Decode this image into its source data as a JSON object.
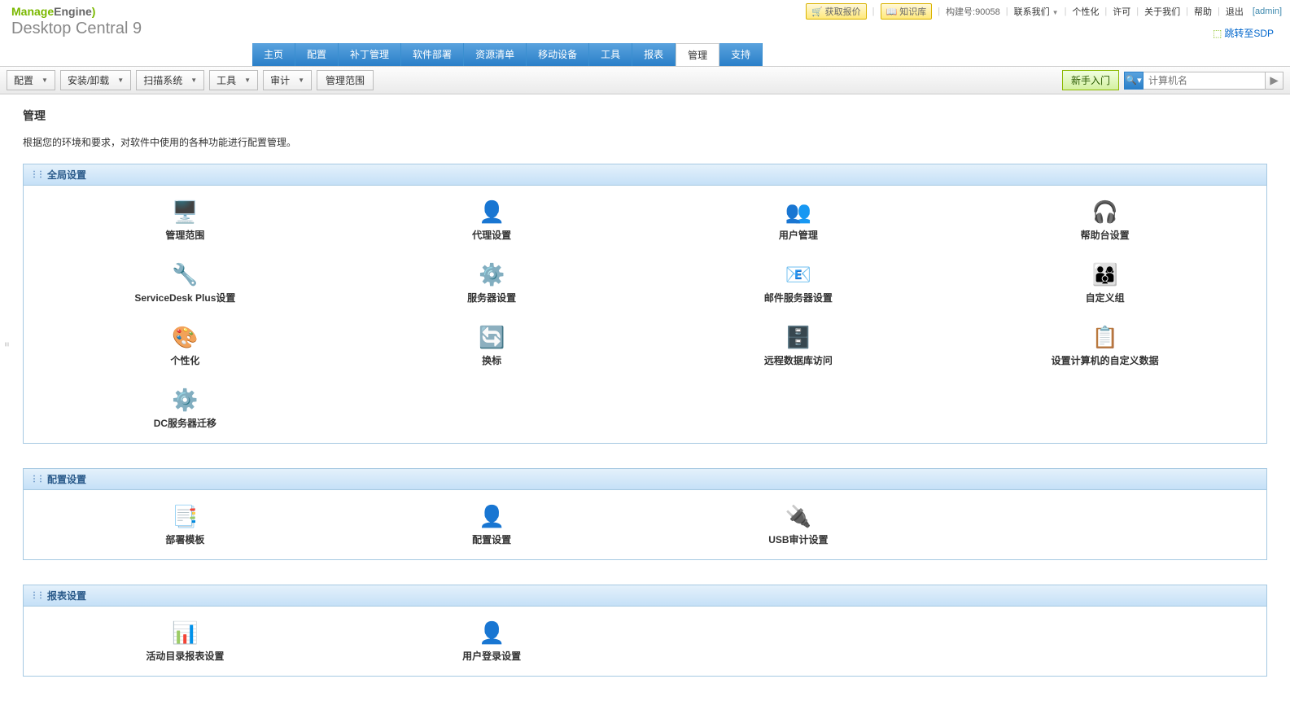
{
  "top": {
    "logo1a": "Manage",
    "logo1b": "Engine",
    "logo2": "Desktop Central 9",
    "btn_quote": "获取报价",
    "btn_kb": "知识库",
    "build": "构建号:90058",
    "contact": "联系我们",
    "personalize": "个性化",
    "license": "许可",
    "about": "关于我们",
    "help": "帮助",
    "logout": "退出",
    "user": "[admin]",
    "sdp": "跳转至SDP"
  },
  "tabs": [
    "主页",
    "配置",
    "补丁管理",
    "软件部署",
    "资源清单",
    "移动设备",
    "工具",
    "报表",
    "管理",
    "支持"
  ],
  "active_tab": 8,
  "subtabs": [
    "配置",
    "安装/卸载",
    "扫描系统",
    "工具",
    "审计",
    "管理范围"
  ],
  "quick_btn": "新手入门",
  "search_placeholder": "计算机名",
  "page": {
    "title": "管理",
    "desc": "根据您的环境和要求，对软件中使用的各种功能进行配置管理。"
  },
  "sections": [
    {
      "title": "全局设置",
      "items": [
        {
          "icon": "🖥️",
          "label": "管理范围"
        },
        {
          "icon": "👤",
          "label": "代理设置"
        },
        {
          "icon": "👥",
          "label": "用户管理"
        },
        {
          "icon": "🎧",
          "label": "帮助台设置"
        },
        {
          "icon": "🔧",
          "label": "ServiceDesk Plus设置"
        },
        {
          "icon": "⚙️",
          "label": "服务器设置"
        },
        {
          "icon": "📧",
          "label": "邮件服务器设置"
        },
        {
          "icon": "👨‍👩‍👦",
          "label": "自定义组"
        },
        {
          "icon": "🎨",
          "label": "个性化"
        },
        {
          "icon": "🔄",
          "label": "换标"
        },
        {
          "icon": "🗄️",
          "label": "远程数据库访问"
        },
        {
          "icon": "📋",
          "label": "设置计算机的自定义数据"
        },
        {
          "icon": "⚙️",
          "label": "DC服务器迁移"
        }
      ]
    },
    {
      "title": "配置设置",
      "items": [
        {
          "icon": "📑",
          "label": "部署模板"
        },
        {
          "icon": "👤",
          "label": "配置设置"
        },
        {
          "icon": "🔌",
          "label": "USB审计设置"
        }
      ]
    },
    {
      "title": "报表设置",
      "items": [
        {
          "icon": "📊",
          "label": "活动目录报表设置"
        },
        {
          "icon": "👤",
          "label": "用户登录设置"
        }
      ]
    }
  ]
}
